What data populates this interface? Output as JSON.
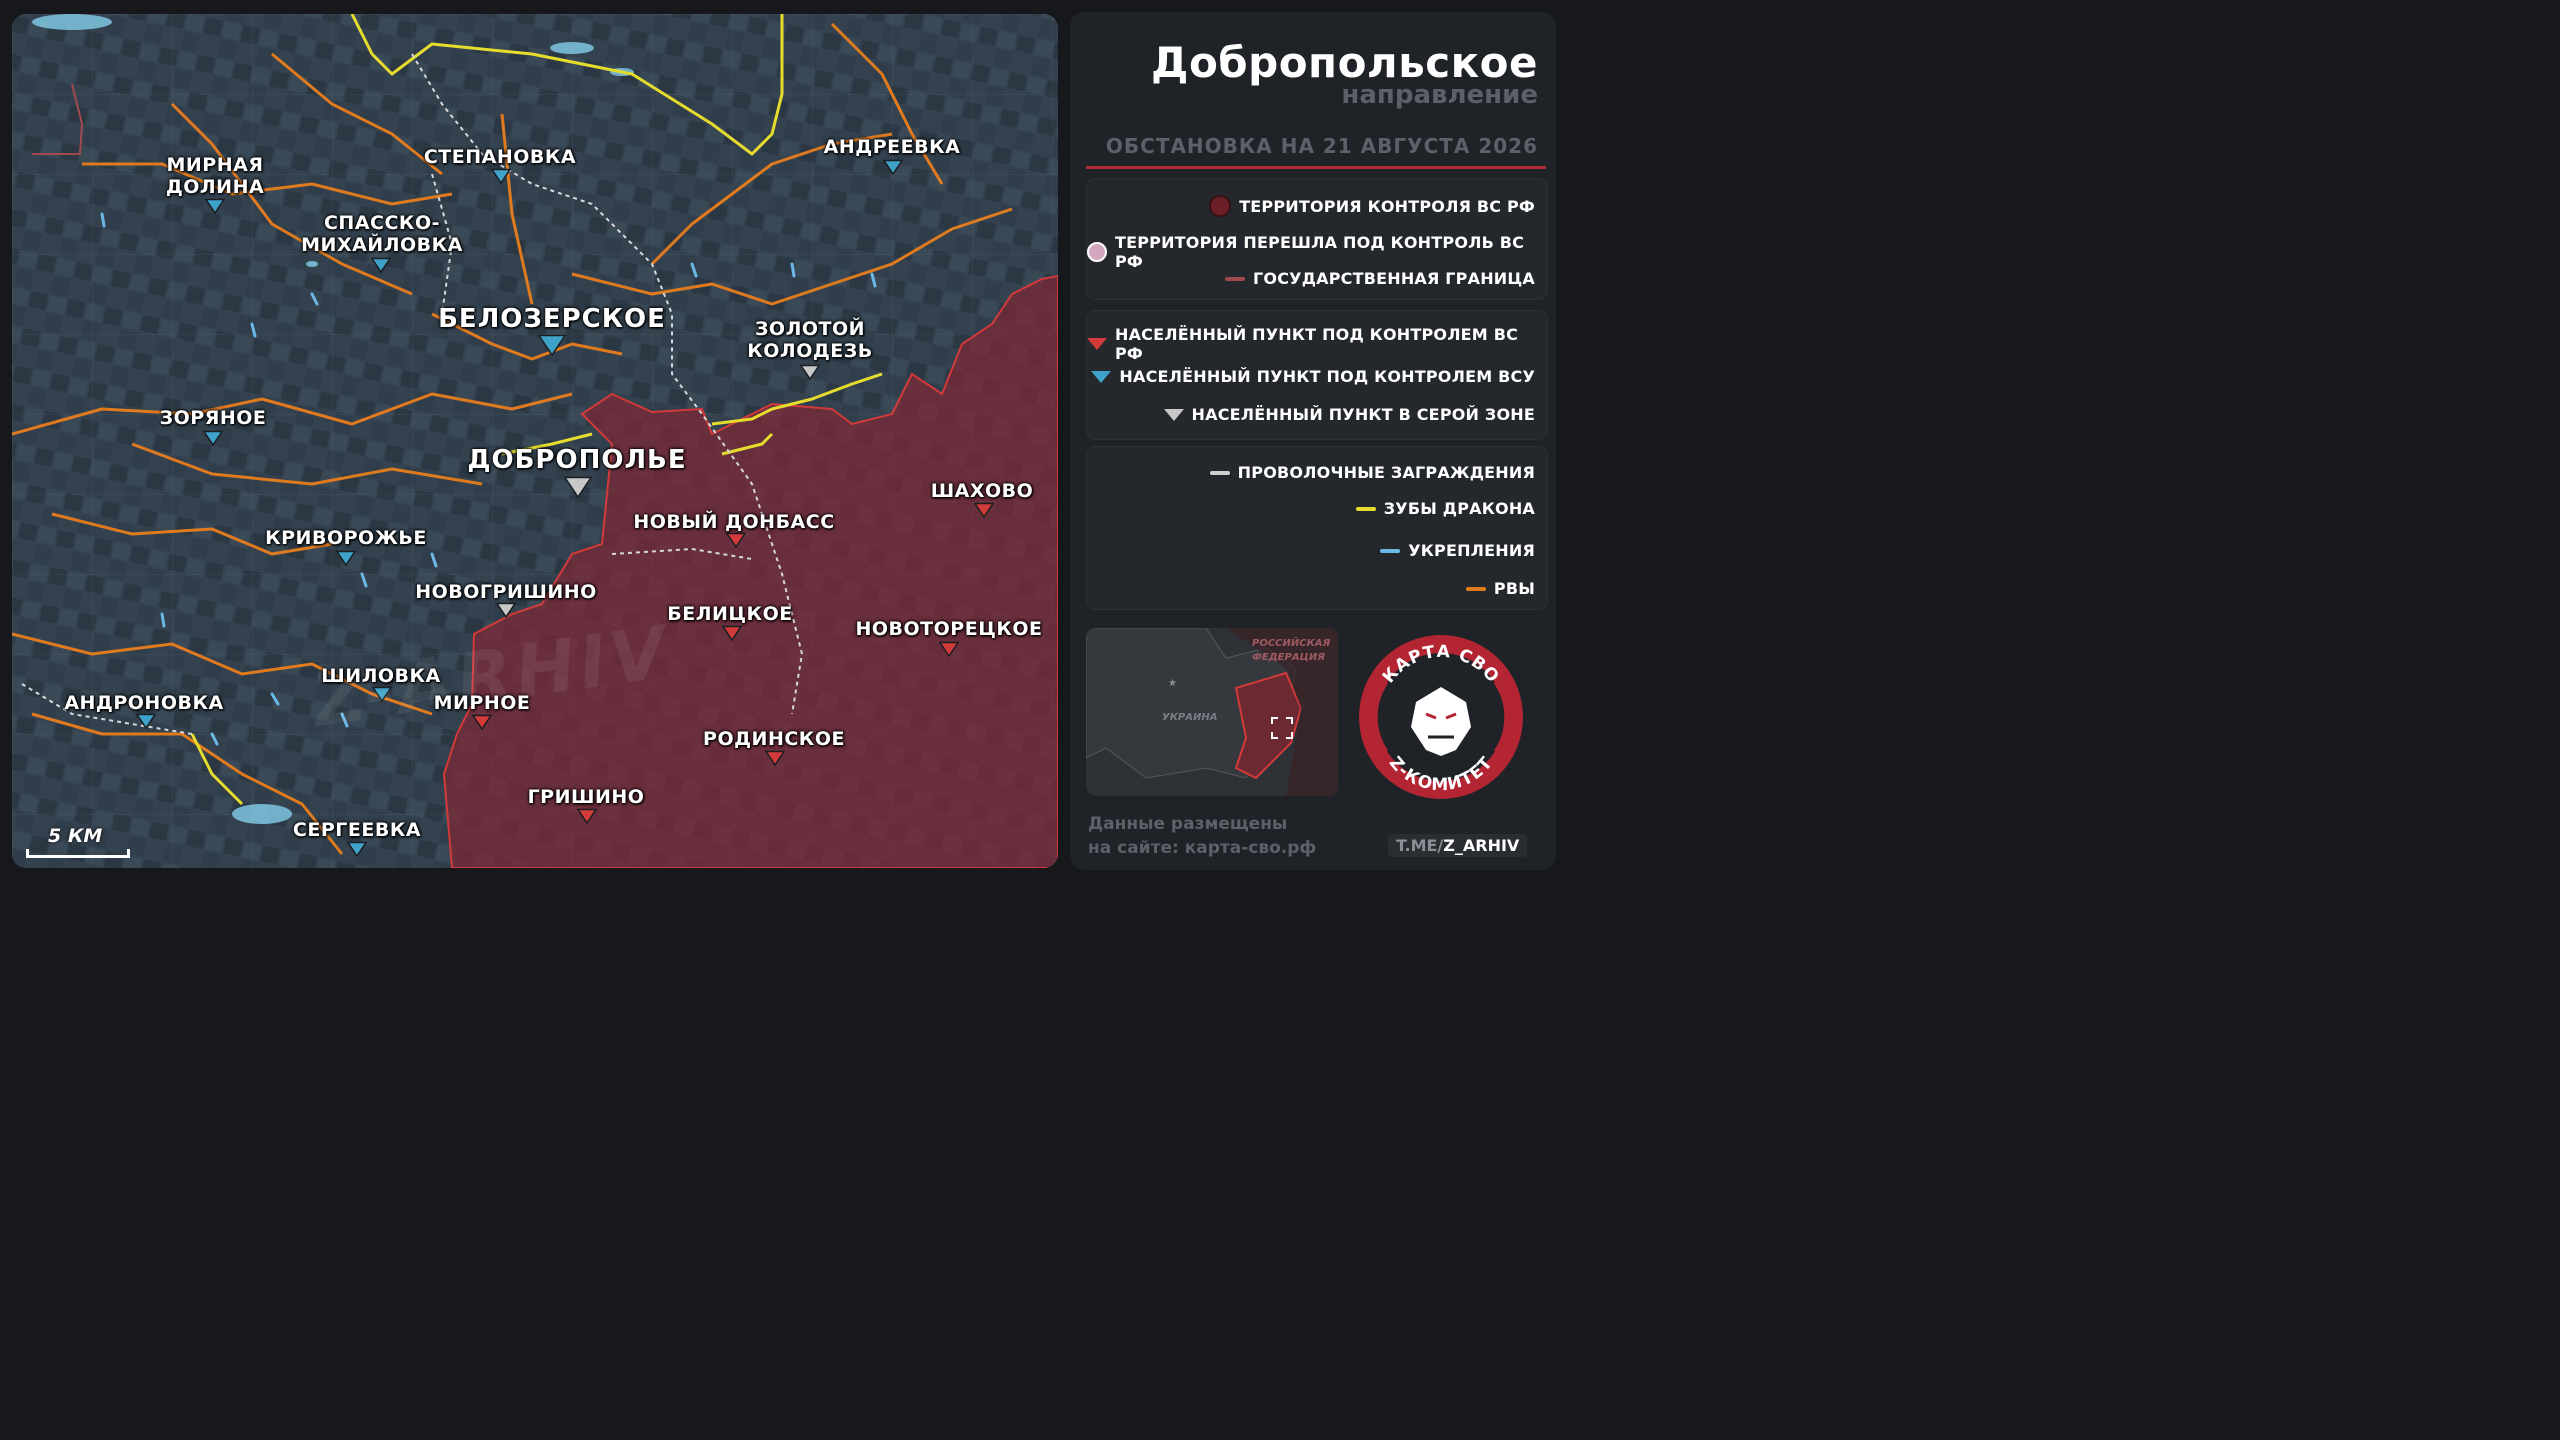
{
  "header": {
    "title": "Добропольское",
    "subtitle": "направление",
    "date": "ОБСТАНОВКА НА 21 АВГУСТА 2026"
  },
  "legend": {
    "territory": [
      {
        "label": "ТЕРРИТОРИЯ КОНТРОЛЯ ВС РФ",
        "color": "#6b1f26"
      },
      {
        "label": "ТЕРРИТОРИЯ ПЕРЕШЛА ПОД КОНТРОЛЬ ВС РФ",
        "color": "#d4a6bf"
      },
      {
        "label": "ГОСУДАРСТВЕННАЯ ГРАНИЦА",
        "color": "#a04a4f"
      }
    ],
    "settlements": [
      {
        "label": "НАСЕЛЁННЫЙ ПУНКТ ПОД КОНТРОЛЕМ ВС РФ",
        "color": "#d33a3a"
      },
      {
        "label": "НАСЕЛЁННЫЙ ПУНКТ ПОД КОНТРОЛЕМ ВСУ",
        "color": "#3fa3c9"
      },
      {
        "label": "НАСЕЛЁННЫЙ ПУНКТ В СЕРОЙ ЗОНЕ",
        "color": "#c8c8c8"
      }
    ],
    "lines": [
      {
        "label": "ПРОВОЛОЧНЫЕ ЗАГРАЖДЕНИЯ",
        "color": "#cfcfcf"
      },
      {
        "label": "ЗУБЫ ДРАКОНА",
        "color": "#e6dc2e"
      },
      {
        "label": "УКРЕПЛЕНИЯ",
        "color": "#6bb8e6"
      },
      {
        "label": "РВЫ",
        "color": "#e07a1f"
      }
    ]
  },
  "map": {
    "scale": "5 КМ",
    "watermark": "Z-ARHIV",
    "towns": [
      {
        "name": "МИРНАЯ ДОЛИНА",
        "line1": "МИРНАЯ",
        "line2": "ДОЛИНА",
        "status": "ua"
      },
      {
        "name": "СТЕПАНОВКА",
        "status": "ua"
      },
      {
        "name": "АНДРЕЕВКА",
        "status": "ua"
      },
      {
        "name": "СПАССКО-МИХАЙЛОВКА",
        "line1": "СПАССКО-",
        "line2": "МИХАЙЛОВКА",
        "status": "ua"
      },
      {
        "name": "БЕЛОЗЕРСКОЕ",
        "status": "ua"
      },
      {
        "name": "ЗОЛОТОЙ КОЛОДЕЗЬ",
        "line1": "ЗОЛОТОЙ",
        "line2": "КОЛОДЕЗЬ",
        "status": "grey"
      },
      {
        "name": "ЗОРЯНОЕ",
        "status": "ua"
      },
      {
        "name": "ДОБРОПОЛЬЕ",
        "status": "grey"
      },
      {
        "name": "ШАХОВО",
        "status": "ru"
      },
      {
        "name": "НОВЫЙ ДОНБАСС",
        "status": "ru"
      },
      {
        "name": "КРИВОРОЖЬЕ",
        "status": "ua"
      },
      {
        "name": "НОВОГРИШИНО",
        "status": "grey"
      },
      {
        "name": "БЕЛИЦКОЕ",
        "status": "ru"
      },
      {
        "name": "НОВОТОРЕЦКОЕ",
        "status": "ru"
      },
      {
        "name": "ШИЛОВКА",
        "status": "ua"
      },
      {
        "name": "АНДРОНОВКА",
        "status": "ua"
      },
      {
        "name": "МИРНОЕ",
        "status": "ru"
      },
      {
        "name": "РОДИНСКОЕ",
        "status": "ru"
      },
      {
        "name": "ГРИШИНО",
        "status": "ru"
      },
      {
        "name": "СЕРГЕЕВКА",
        "status": "ua"
      }
    ]
  },
  "inset": {
    "russia": "РОССИЙСКАЯ ФЕДЕРАЦИЯ",
    "russia_l1": "РОССИЙСКАЯ",
    "russia_l2": "ФЕДЕРАЦИЯ",
    "ukraine": "УКРАИНА"
  },
  "emblem": {
    "top": "КАРТА СВО",
    "bottom": "Z-КОМИТЕТ"
  },
  "footer": {
    "line1": "Данные размещены",
    "line2": "на сайте: карта-сво.рф",
    "handle_prefix": "T.ME/",
    "handle": "Z_ARHIV"
  }
}
